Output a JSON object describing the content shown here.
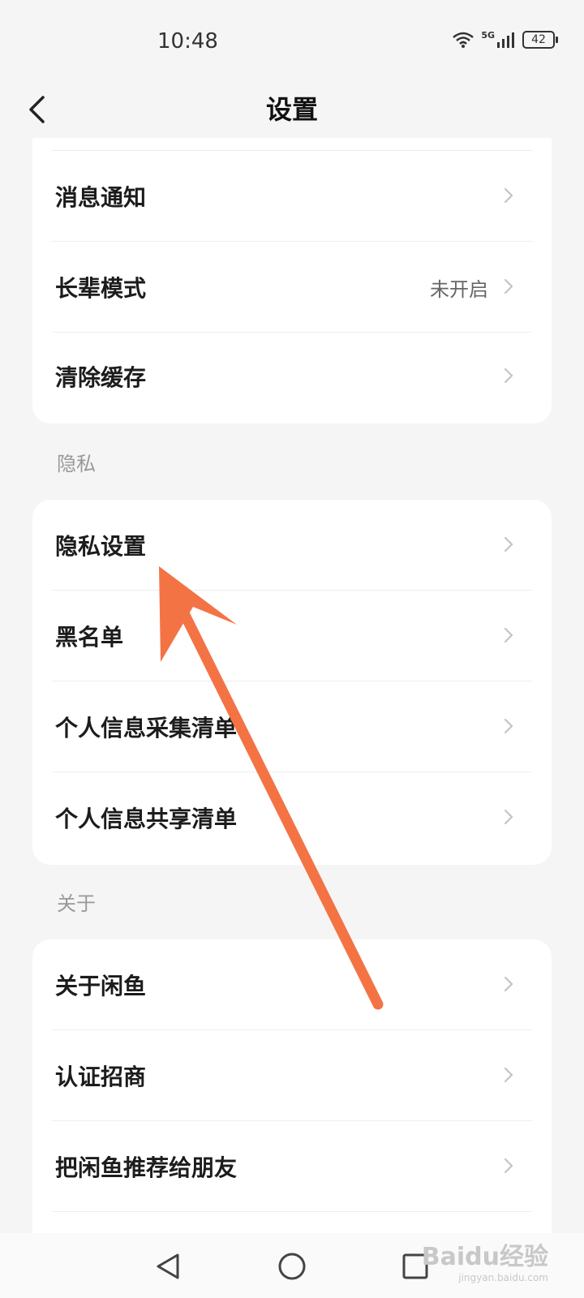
{
  "status": {
    "time": "10:48",
    "network": "5G",
    "battery": "42",
    "icons": [
      "wifi-icon",
      "signal-icon",
      "battery-icon"
    ]
  },
  "header": {
    "title": "设置",
    "back_icon": "chevron-left-icon"
  },
  "general": {
    "items": [
      {
        "label": "消息通知",
        "value": ""
      },
      {
        "label": "长辈模式",
        "value": "未开启"
      },
      {
        "label": "清除缓存",
        "value": ""
      }
    ]
  },
  "privacy": {
    "section_title": "隐私",
    "items": [
      {
        "label": "隐私设置"
      },
      {
        "label": "黑名单"
      },
      {
        "label": "个人信息采集清单"
      },
      {
        "label": "个人信息共享清单"
      }
    ]
  },
  "about": {
    "section_title": "关于",
    "items": [
      {
        "label": "关于闲鱼"
      },
      {
        "label": "认证招商"
      },
      {
        "label": "把闲鱼推荐给朋友"
      }
    ]
  },
  "watermark": {
    "main": "Baidu经验",
    "sub": "jingyan.baidu.com"
  },
  "colors": {
    "background": "#f5f5f5",
    "card": "#ffffff",
    "annotation_arrow": "#f47345"
  }
}
